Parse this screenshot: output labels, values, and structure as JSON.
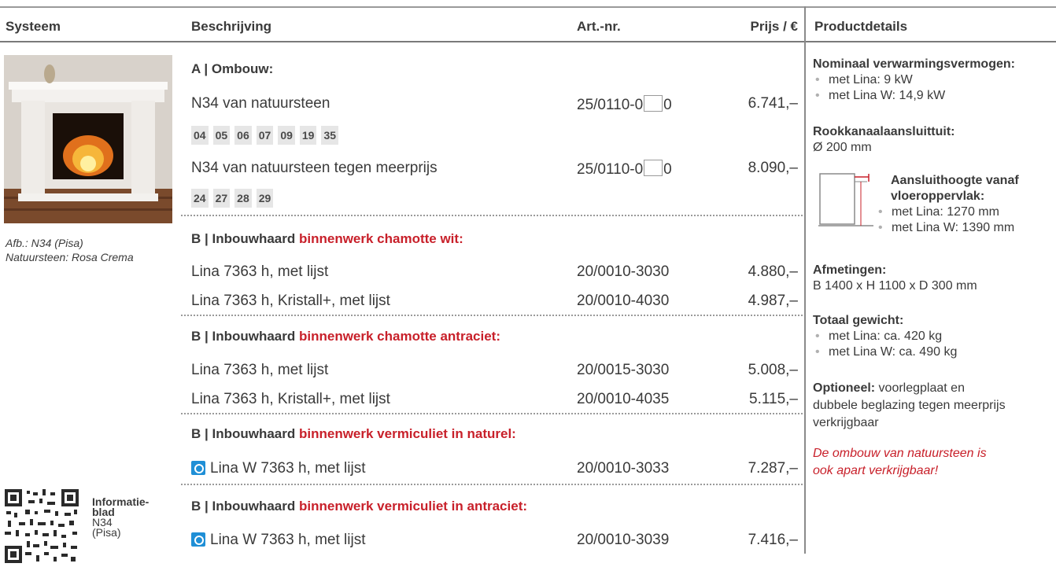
{
  "header": {
    "systeem": "Systeem",
    "beschrijving": "Beschrijving",
    "artnr": "Art.-nr.",
    "prijs": "Prijs / €",
    "details": "Productdetails"
  },
  "left": {
    "caption_1": "Afb.: N34 (Pisa)",
    "caption_2": "Natuursteen: Rosa Crema",
    "info_title_1": "Informatie-",
    "info_title_2": "blad",
    "info_sub_1": "N34",
    "info_sub_2": "(Pisa)"
  },
  "sections": {
    "a_title": "A | Ombouw:",
    "a_rows": [
      {
        "desc": "N34 van natuursteen",
        "art_pre": "25/0110-0",
        "art_post": "0",
        "price": "6.741,–"
      },
      {
        "desc": "N34 van natuursteen tegen meerprijs",
        "art_pre": "25/0110-0",
        "art_post": "0",
        "price": "8.090,–"
      }
    ],
    "chips_1": [
      "04",
      "05",
      "06",
      "07",
      "09",
      "19",
      "35"
    ],
    "chips_2": [
      "24",
      "27",
      "28",
      "29"
    ],
    "b1_prefix": "B | Inbouwhaard ",
    "b1_red": "binnenwerk chamotte wit:",
    "b1_rows": [
      {
        "desc": "Lina 7363 h, met lijst",
        "art": "20/0010-3030",
        "price": "4.880,–"
      },
      {
        "desc": "Lina 7363 h, Kristall+, met lijst",
        "art": "20/0010-4030",
        "price": "4.987,–"
      }
    ],
    "b2_prefix": "B | Inbouwhaard ",
    "b2_red": "binnenwerk chamotte antraciet:",
    "b2_rows": [
      {
        "desc": "Lina 7363 h, met lijst",
        "art": "20/0015-3030",
        "price": "5.008,–"
      },
      {
        "desc": "Lina 7363 h, Kristall+, met lijst",
        "art": "20/0010-4035",
        "price": "5.115,–"
      }
    ],
    "b3_prefix": "B | Inbouwhaard ",
    "b3_red": "binnenwerk vermiculiet in naturel:",
    "b3_rows": [
      {
        "desc": "Lina W 7363 h, met lijst",
        "art": "20/0010-3033",
        "price": "7.287,–"
      }
    ],
    "b4_prefix": "B | Inbouwhaard ",
    "b4_red": "binnenwerk vermiculiet in antraciet:",
    "b4_rows": [
      {
        "desc": "Lina W 7363 h, met lijst",
        "art": "20/0010-3039",
        "price": "7.416,–"
      }
    ]
  },
  "details": {
    "nom_title": "Nominaal verwarmingsvermogen:",
    "nom_items": [
      "met Lina: 9 kW",
      "met Lina W: 14,9 kW"
    ],
    "rook_title": "Rookkanaalaansluittuit:",
    "rook_value": "Ø 200 mm",
    "aans_title_1": "Aansluithoogte vanaf",
    "aans_title_2": "vloeroppervlak:",
    "aans_items": [
      "met Lina: 1270 mm",
      "met Lina W: 1390 mm"
    ],
    "afm_title": "Afmetingen:",
    "afm_value": "B 1400 x H 1100 x D 300 mm",
    "gew_title": "Totaal gewicht:",
    "gew_items": [
      "met Lina: ca. 420 kg",
      "met Lina W: ca. 490 kg"
    ],
    "opt_bold": "Optioneel:",
    "opt_text_1": " voorlegplaat en",
    "opt_text_2": "dubbele beglazing tegen meerprijs",
    "opt_text_3": "verkrijgbaar",
    "note_1": "De ombouw van natuursteen is",
    "note_2": "ook apart verkrijgbaar!"
  },
  "colors": {
    "accent_red": "#c8202a",
    "eco_blue": "#1f8fd6"
  }
}
